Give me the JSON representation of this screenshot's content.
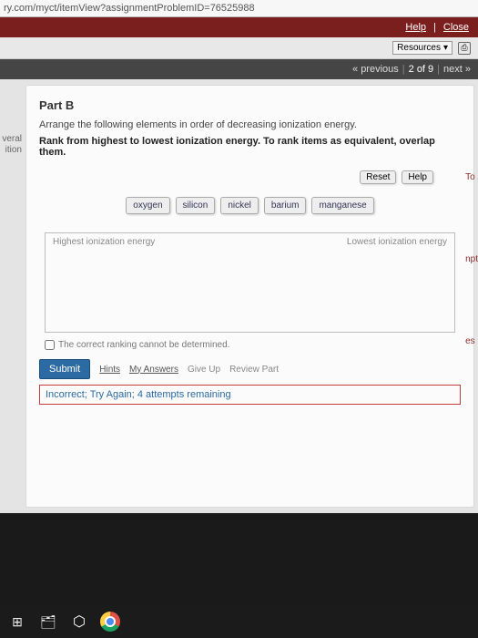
{
  "url": "ry.com/myct/itemView?assignmentProblemID=76525988",
  "topbar": {
    "help": "Help",
    "close": "Close"
  },
  "toolbar": {
    "resources": "Resources"
  },
  "nav": {
    "prev": "« previous",
    "counter": "2 of 9",
    "next": "next »"
  },
  "left_cut": {
    "line1": "veral",
    "line2": "ition"
  },
  "part": {
    "title": "Part B",
    "instr1": "Arrange the following elements in order of decreasing ionization energy.",
    "instr2_prefix": "Rank from highest to lowest ionization energy. To rank items as equivalent, overlap them."
  },
  "controls": {
    "reset": "Reset",
    "help": "Help"
  },
  "items": [
    "oxygen",
    "silicon",
    "nickel",
    "barium",
    "manganese"
  ],
  "rank": {
    "left": "Highest ionization energy",
    "right": "Lowest ionization energy"
  },
  "determined": "The correct ranking cannot be determined.",
  "actions": {
    "submit": "Submit",
    "hints": "Hints",
    "my_answers": "My Answers",
    "give_up": "Give Up",
    "review": "Review Part"
  },
  "feedback": "Incorrect; Try Again; 4 attempts remaining",
  "right_edge": {
    "a": "To",
    "b": "npt",
    "c": "es"
  }
}
